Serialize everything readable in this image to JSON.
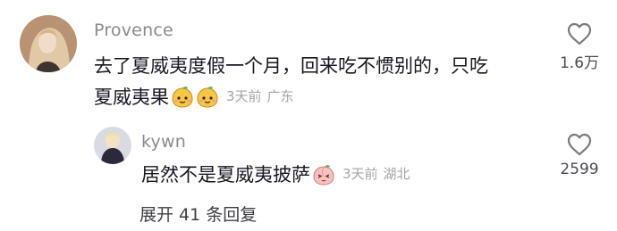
{
  "comments": [
    {
      "username": "Provence",
      "text_line1": "去了夏威夷度假一个月，回来吃不惯别的，只吃",
      "text_line2": "夏威夷果",
      "emojis": [
        "mango-face-emoji",
        "mango-face-emoji"
      ],
      "time": "3天前",
      "location": "广东",
      "likes": "1.6万"
    },
    {
      "username": "kywn",
      "text": "居然不是夏威夷披萨",
      "emojis": [
        "peach-face-emoji"
      ],
      "time": "3天前",
      "location": "湖北",
      "likes": "2599"
    }
  ],
  "expand_label": "展开 41 条回复"
}
